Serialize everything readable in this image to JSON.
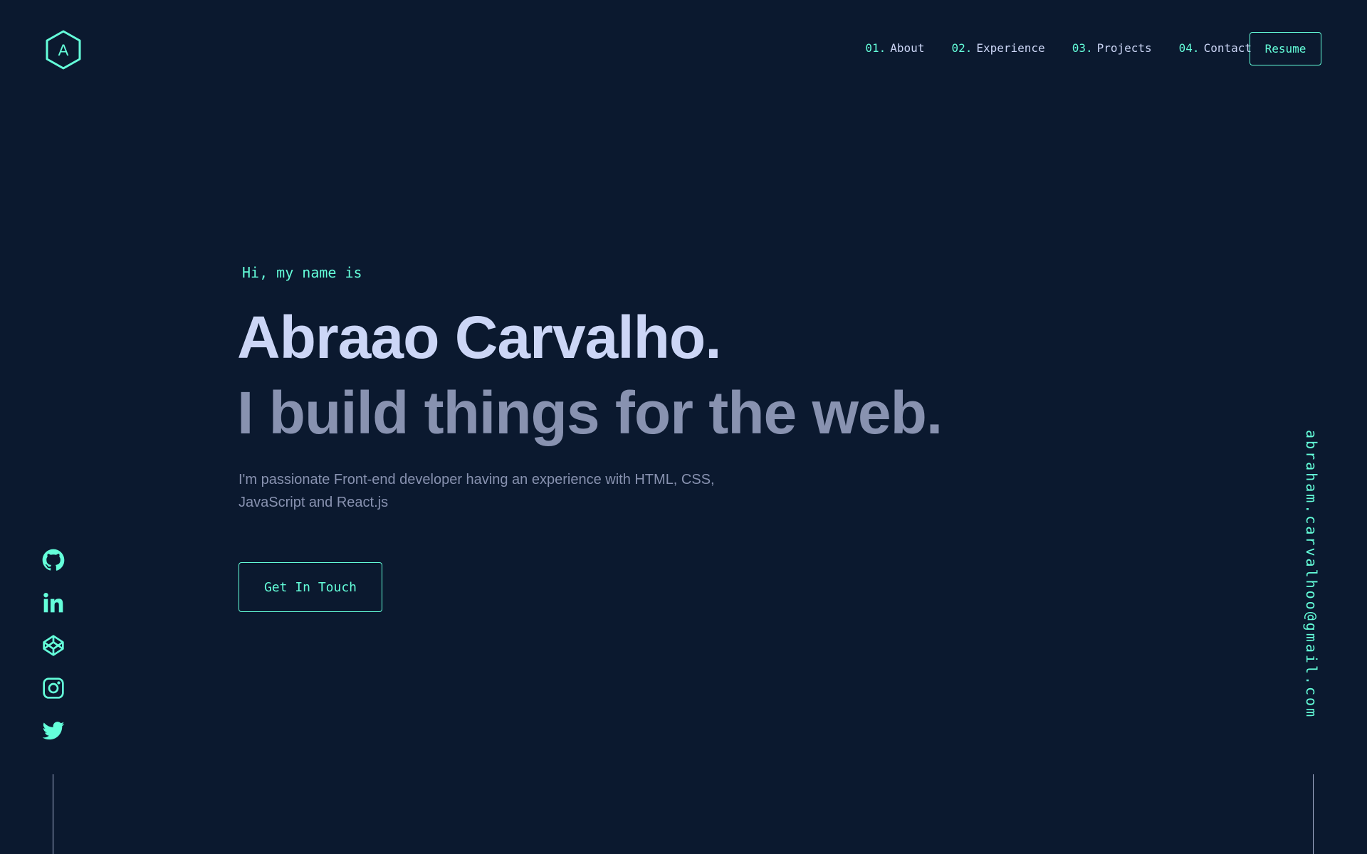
{
  "header": {
    "logo_letter": "A",
    "nav": [
      {
        "num": "01.",
        "label": "About"
      },
      {
        "num": "02.",
        "label": "Experience"
      },
      {
        "num": "03.",
        "label": "Projects"
      },
      {
        "num": "04.",
        "label": "Contact"
      }
    ],
    "resume_label": "Resume"
  },
  "hero": {
    "greeting": "Hi, my name is",
    "name": "Abraao Carvalho.",
    "tagline": "I build things for the web.",
    "description": "I'm passionate Front-end developer having an experience with HTML, CSS, JavaScript and React.js",
    "cta_label": "Get In Touch"
  },
  "social": {
    "icons": [
      "github-icon",
      "linkedin-icon",
      "codepen-icon",
      "instagram-icon",
      "twitter-icon"
    ]
  },
  "email": "abraham.carvalhoo@gmail.com",
  "colors": {
    "background": "#0b192f",
    "accent": "#64ffda",
    "heading": "#ccd6f6",
    "muted": "#8892b0"
  }
}
